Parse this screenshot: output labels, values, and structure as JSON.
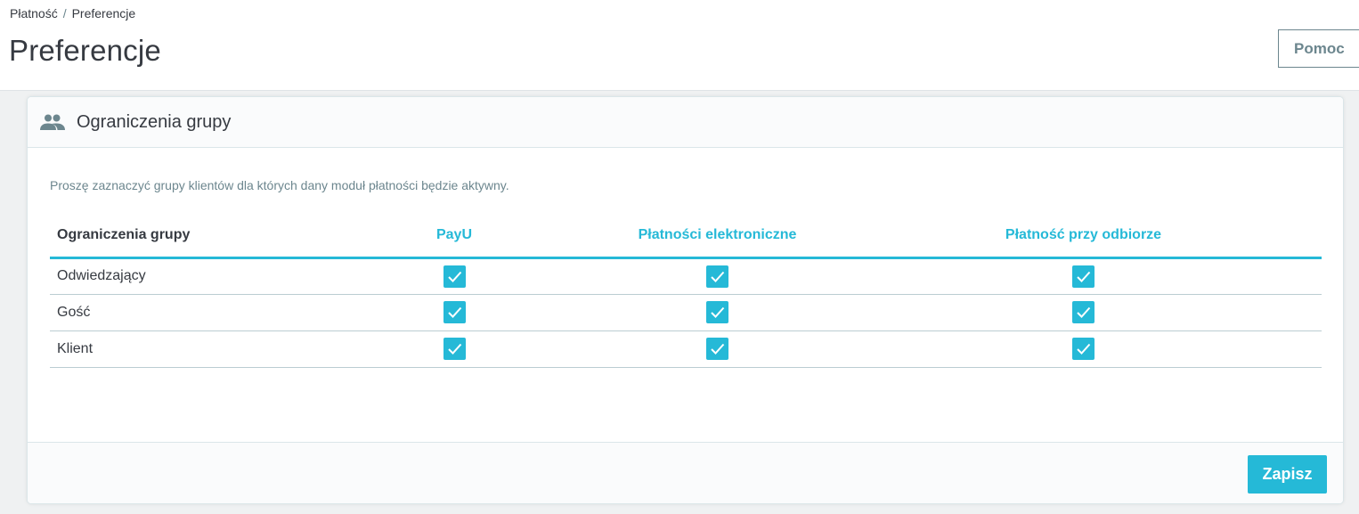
{
  "header": {
    "breadcrumb": [
      "Płatność",
      "Preferencje"
    ],
    "breadcrumb_separator": "/",
    "title": "Preferencje",
    "help_label": "Pomoc"
  },
  "card": {
    "title": "Ograniczenia grupy",
    "icon": "users-icon",
    "description": "Proszę zaznaczyć grupy klientów dla których dany moduł płatności będzie aktywny.",
    "table": {
      "columns": [
        "Ograniczenia grupy",
        "PayU",
        "Płatności elektroniczne",
        "Płatność przy odbiorze"
      ],
      "rows": [
        {
          "name": "Odwiedzający",
          "checked": [
            true,
            true,
            true
          ]
        },
        {
          "name": "Gość",
          "checked": [
            true,
            true,
            true
          ]
        },
        {
          "name": "Klient",
          "checked": [
            true,
            true,
            true
          ]
        }
      ]
    },
    "save_label": "Zapisz"
  },
  "colors": {
    "accent": "#25b9d7",
    "text": "#363a41",
    "muted": "#6c868e"
  }
}
